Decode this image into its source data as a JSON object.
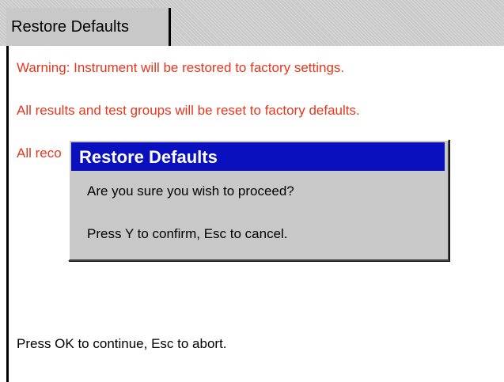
{
  "tab": {
    "label": "Restore Defaults"
  },
  "content": {
    "warning_line1": "Warning: Instrument will be restored to factory settings.",
    "warning_line2": "All results and test groups will be reset to factory defaults.",
    "warning_line3_partial": "All reco",
    "footer": "Press OK to continue, Esc to abort."
  },
  "dialog": {
    "title": "Restore Defaults",
    "question": "Are you sure you wish to proceed?",
    "instructions": "Press Y to confirm, Esc to cancel."
  },
  "colors": {
    "warning_text": "#e8361c",
    "dialog_titlebar": "#0a10bd",
    "panel_gray": "#c8c8c8"
  }
}
